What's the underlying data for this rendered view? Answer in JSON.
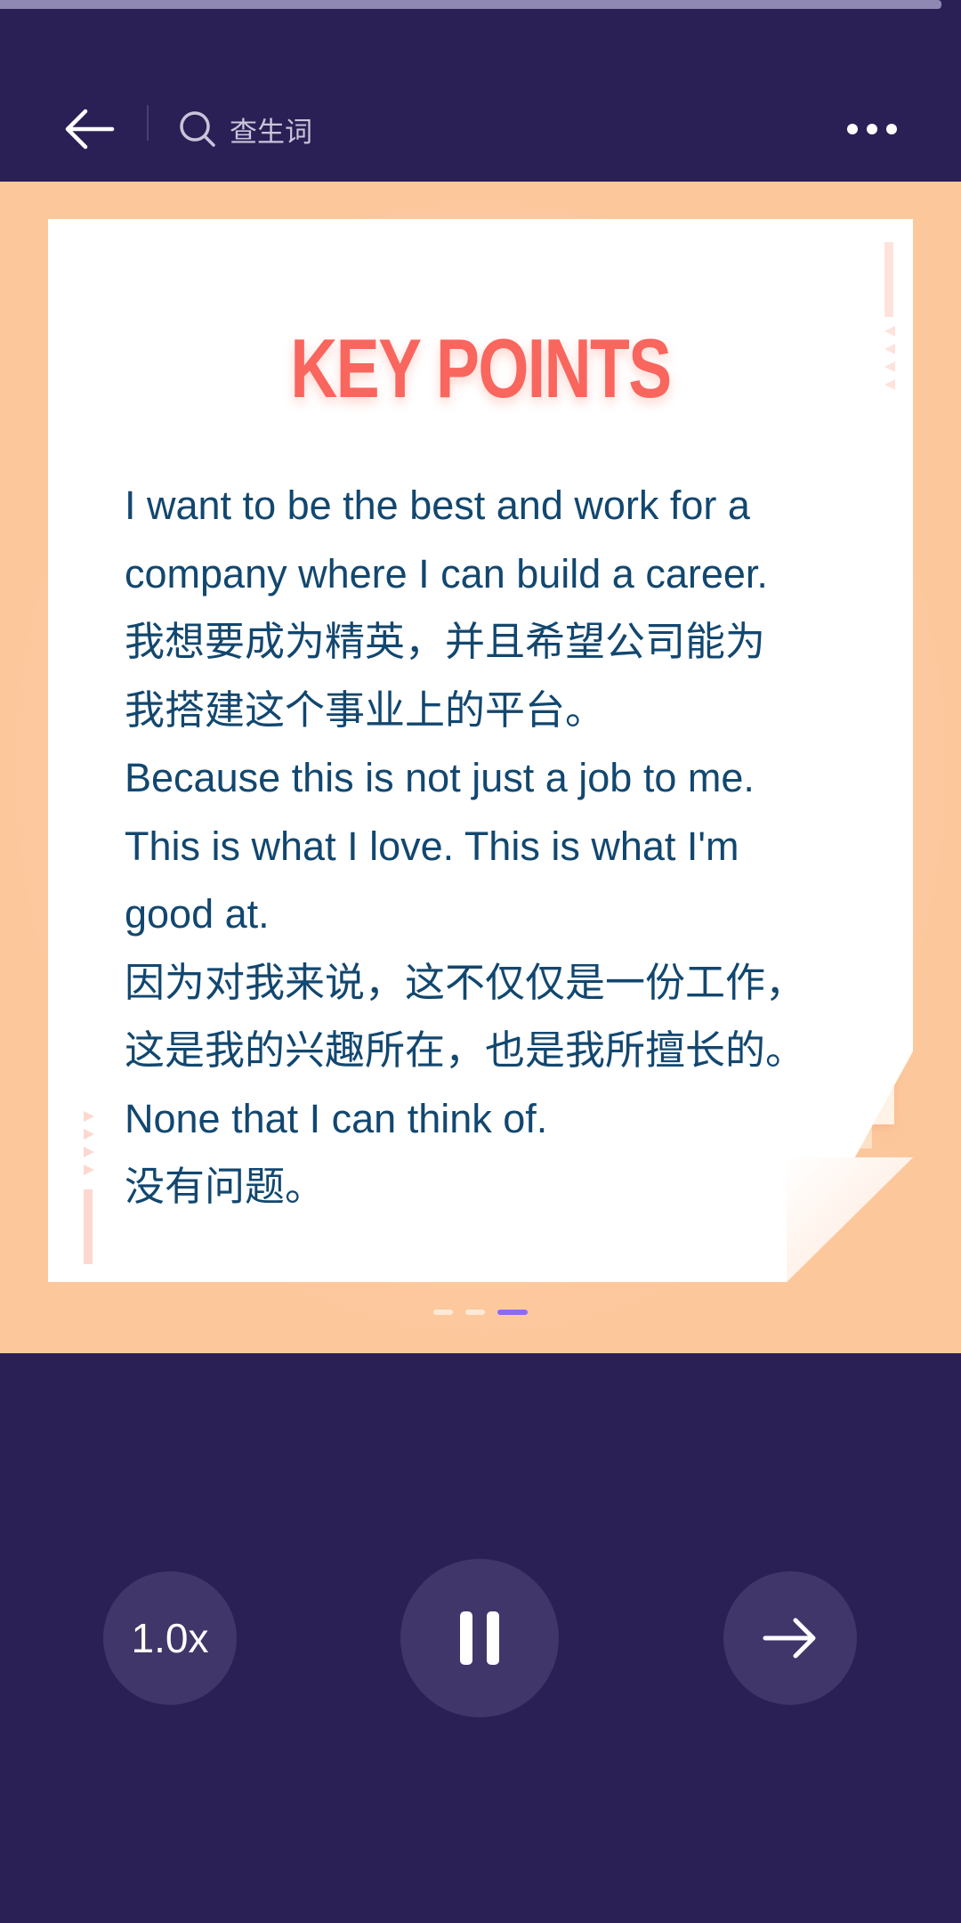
{
  "progress": {
    "fraction": 0.98
  },
  "header": {
    "back_icon": "arrow-left-icon",
    "search_icon": "search-icon",
    "search_label": "查生词",
    "more_icon": "more-horizontal-icon"
  },
  "card": {
    "title": "KEY POINTS",
    "lines": [
      "I want to be the best and work for a",
      "company where I can build a career.",
      "我想要成为精英，并且希望公司能为",
      "我搭建这个事业上的平台。",
      "Because this is not just a job to me.",
      "This is what I love. This is what I'm",
      "good at.",
      "因为对我来说，这不仅仅是一份工作，",
      "这是我的兴趣所在，也是我所擅长的。",
      "None that I can think of.",
      "没有问题。"
    ]
  },
  "pager": {
    "count": 3,
    "active_index": 2
  },
  "controls": {
    "speed_label": "1.0x",
    "pause_icon": "pause-icon",
    "next_icon": "arrow-right-icon"
  },
  "colors": {
    "background": "#2b2055",
    "stage": "#fdc79c",
    "title": "#f8665e",
    "text": "#12476f",
    "control_circle": "#41366a",
    "pager_active": "#8a6cf0"
  }
}
